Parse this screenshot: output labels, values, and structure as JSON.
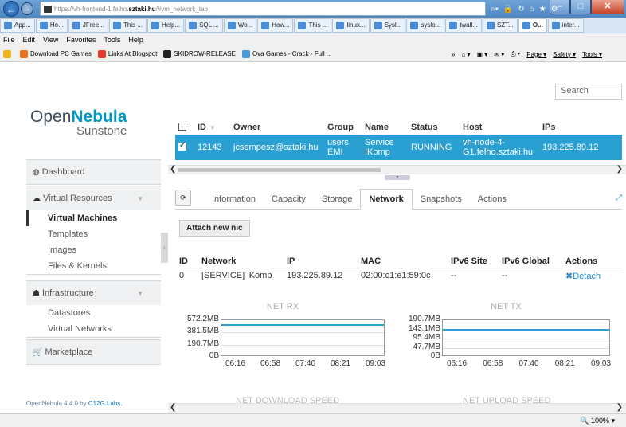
{
  "browser": {
    "url_prefix": "https://vh-frontend-1.felho.",
    "url_host": "sztaki.hu",
    "url_suffix": "/#vm_network_tab",
    "tabs": [
      {
        "label": "App..."
      },
      {
        "label": "Ho..."
      },
      {
        "label": "JFree..."
      },
      {
        "label": "This ..."
      },
      {
        "label": "Help..."
      },
      {
        "label": "SQL ..."
      },
      {
        "label": "Wo..."
      },
      {
        "label": "How..."
      },
      {
        "label": "This ..."
      },
      {
        "label": "linux..."
      },
      {
        "label": "Sysl..."
      },
      {
        "label": "syslo..."
      },
      {
        "label": "twall..."
      },
      {
        "label": "SZT..."
      },
      {
        "label": "O...",
        "active": true
      },
      {
        "label": "inter..."
      }
    ],
    "menu": [
      "File",
      "Edit",
      "View",
      "Favorites",
      "Tools",
      "Help"
    ],
    "favorites": [
      {
        "label": "Download PC Games",
        "color": "#e8731a"
      },
      {
        "label": "Links At Blogspot",
        "color": "#e53b2c"
      },
      {
        "label": "SKIDROW-RELEASE",
        "color": "#222222"
      },
      {
        "label": "Ova Games - Crack - Full ...",
        "color": "#4a9ad8"
      }
    ],
    "commands": [
      "Page ▾",
      "Safety ▾",
      "Tools ▾"
    ],
    "zoom": "100%"
  },
  "sidebar": {
    "logo_open": "Open",
    "logo_nebula": "Nebula",
    "logo_sunstone": "Sunstone",
    "dashboard": "Dashboard",
    "virtual_resources": "Virtual Resources",
    "vr_items": [
      "Virtual Machines",
      "Templates",
      "Images",
      "Files & Kernels"
    ],
    "infrastructure": "Infrastructure",
    "infra_items": [
      "Datastores",
      "Virtual Networks"
    ],
    "marketplace": "Marketplace",
    "footer_text": "OpenNebula 4.4.0 by ",
    "footer_link": "C12G Labs."
  },
  "vm_table": {
    "search_placeholder": "Search",
    "headers": [
      "ID",
      "Owner",
      "Group",
      "Name",
      "Status",
      "Host",
      "IPs"
    ],
    "row": {
      "id": "12143",
      "owner": "jcsempesz@sztaki.hu",
      "group_line1": "users",
      "group_line2": "EMI",
      "name_line1": "Service",
      "name_line2": "IKomp",
      "status": "RUNNING",
      "host_line1": "vh-node-4-",
      "host_line2": "G1.felho.sztaki.hu",
      "ips": "193.225.89.12"
    }
  },
  "detail_tabs": [
    "Information",
    "Capacity",
    "Storage",
    "Network",
    "Snapshots",
    "Actions"
  ],
  "attach_button": "Attach new nic",
  "nic_table": {
    "headers": [
      "ID",
      "Network",
      "IP",
      "MAC",
      "IPv6 Site",
      "IPv6 Global",
      "Actions"
    ],
    "rows": [
      {
        "id": "0",
        "network": "[SERVICE] iKomp",
        "ip": "193.225.89.12",
        "mac": "02:00:c1:e1:59:0c",
        "ipv6_site": "--",
        "ipv6_global": "--",
        "action": "Detach"
      }
    ]
  },
  "chart_data": [
    {
      "type": "line",
      "title": "NET RX",
      "x": [
        "06:16",
        "06:58",
        "07:40",
        "08:21",
        "09:03"
      ],
      "yticks": [
        "572.2MB",
        "381.5MB",
        "190.7MB",
        "0B"
      ],
      "ylim": [
        0,
        572.2
      ],
      "series": [
        {
          "values": [
            500,
            500,
            500,
            500,
            500
          ]
        }
      ]
    },
    {
      "type": "line",
      "title": "NET TX",
      "x": [
        "06:16",
        "06:58",
        "07:40",
        "08:21",
        "09:03"
      ],
      "yticks": [
        "190.7MB",
        "143.1MB",
        "95.4MB",
        "47.7MB",
        "0B"
      ],
      "ylim": [
        0,
        190.7
      ],
      "series": [
        {
          "values": [
            143,
            143,
            143,
            143,
            143
          ]
        }
      ]
    }
  ],
  "lower_sections": [
    "NET DOWNLOAD SPEED",
    "NET UPLOAD SPEED"
  ]
}
